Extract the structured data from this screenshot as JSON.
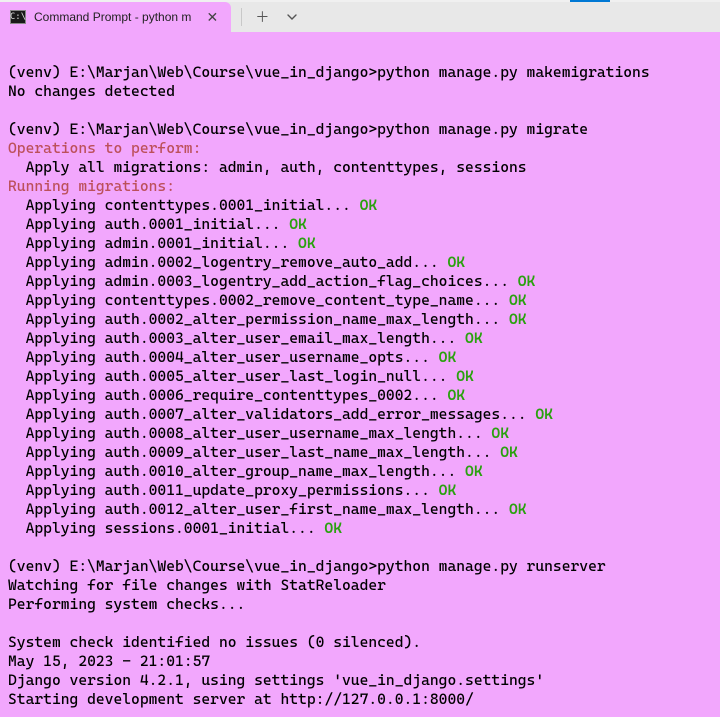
{
  "tab": {
    "title": "Command Prompt - python  m",
    "icon_text": "C:\\"
  },
  "prompt_prefix": "(venv) E:\\Marjan\\Web\\Course\\vue_in_django>",
  "cmds": {
    "makemigrations": "python manage.py makemigrations",
    "migrate": "python manage.py migrate",
    "runserver": "python manage.py runserver"
  },
  "no_changes": "No changes detected",
  "hdr_ops": "Operations to perform:",
  "apply_all": "  Apply all migrations: admin, auth, contenttypes, sessions",
  "hdr_run": "Running migrations:",
  "migrations": [
    "contenttypes.0001_initial",
    "auth.0001_initial",
    "admin.0001_initial",
    "admin.0002_logentry_remove_auto_add",
    "admin.0003_logentry_add_action_flag_choices",
    "contenttypes.0002_remove_content_type_name",
    "auth.0002_alter_permission_name_max_length",
    "auth.0003_alter_user_email_max_length",
    "auth.0004_alter_user_username_opts",
    "auth.0005_alter_user_last_login_null",
    "auth.0006_require_contenttypes_0002",
    "auth.0007_alter_validators_add_error_messages",
    "auth.0008_alter_user_username_max_length",
    "auth.0009_alter_user_last_name_max_length",
    "auth.0010_alter_group_name_max_length",
    "auth.0011_update_proxy_permissions",
    "auth.0012_alter_user_first_name_max_length",
    "sessions.0001_initial"
  ],
  "ok": "OK",
  "runserver_out": {
    "watching": "Watching for file changes with StatReloader",
    "checks": "Performing system checks...",
    "issues": "System check identified no issues (0 silenced).",
    "timestamp": "May 15, 2023 - 21:01:57",
    "version": "Django version 4.2.1, using settings 'vue_in_django.settings'",
    "serving": "Starting development server at http://127.0.0.1:8000/"
  }
}
